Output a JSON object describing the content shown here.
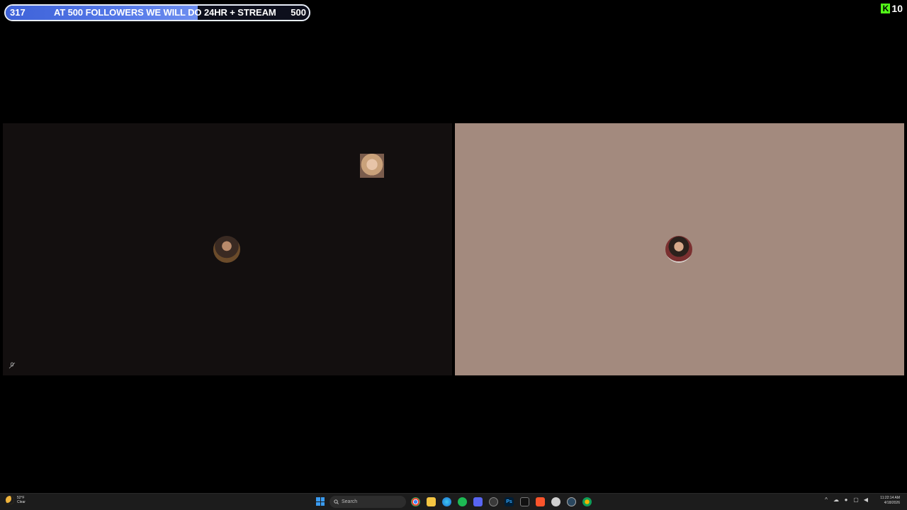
{
  "goal": {
    "current": "317",
    "text": "AT 500 FOLLOWERS WE WILL DO 24HR + STREAM",
    "target": "500",
    "progress_fraction": 0.634,
    "fill_color": "#5478e8"
  },
  "kick": {
    "logo_letter": "K",
    "viewer_count": "10",
    "brand_color": "#53fc18"
  },
  "tiles": {
    "left": {
      "background": "#130f0f",
      "avatar": "participant-avatar",
      "small_video": "participant-thumbnail",
      "muted_icon": "mic-off-icon"
    },
    "right": {
      "background": "#a38a7e",
      "avatar": "participant-avatar"
    }
  },
  "taskbar": {
    "weather": {
      "temp": "52°F",
      "condition": "Clear"
    },
    "search_placeholder": "Search",
    "apps": [
      "chrome-icon",
      "file-explorer-icon",
      "edge-icon",
      "spotify-icon",
      "discord-icon",
      "obs-icon",
      "photoshop-icon",
      "terminal-icon",
      "brave-icon",
      "app-icon",
      "steam-icon",
      "chrome-dev-icon"
    ],
    "time": "11:22:14 AM",
    "date": "4/18/2026"
  }
}
